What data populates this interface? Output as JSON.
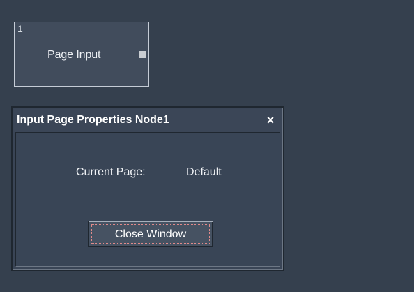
{
  "node": {
    "index": "1",
    "label": "Page Input"
  },
  "dialog": {
    "title": "Input Page Properties Node1",
    "close_glyph": "×",
    "current_page_label": "Current Page:",
    "current_page_value": "Default",
    "close_window_label": "Close Window"
  },
  "colors": {
    "canvas": "#35404e",
    "node_fill": "#414c5c",
    "node_border": "#c5ccd6",
    "dialog_fill": "#394556",
    "dialog_border": "#1f2730",
    "text": "#ffffff",
    "focus_ring": "#e08a8a"
  },
  "icons": {
    "node_output_port": "output-port-icon",
    "dialog_close": "close-icon"
  }
}
